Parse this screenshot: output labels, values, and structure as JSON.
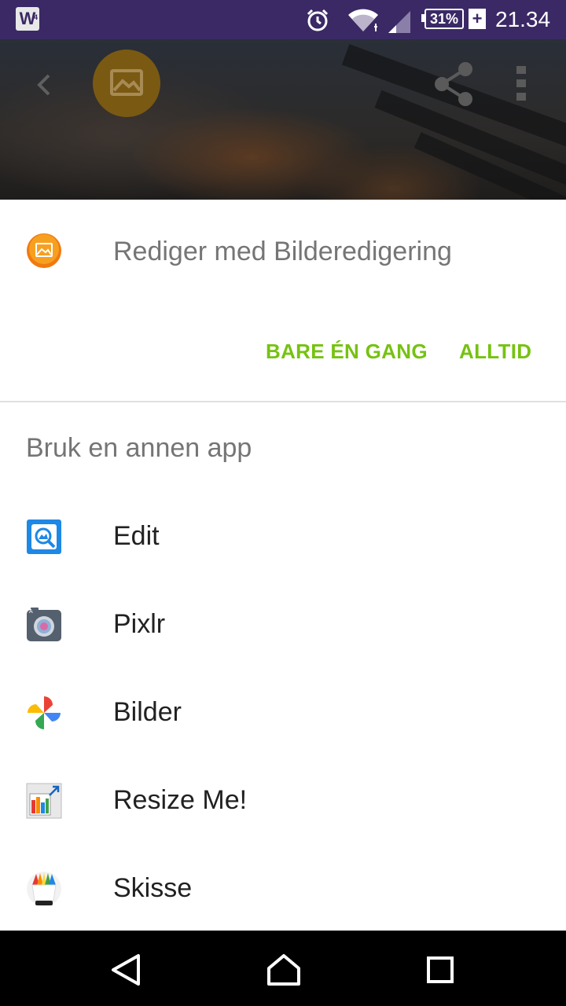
{
  "status_bar": {
    "notification_icon": "W",
    "battery": "31%",
    "charge_icon": "+",
    "time": "21.34",
    "icons": [
      "alarm-icon",
      "wifi-icon",
      "signal-icon",
      "battery-icon"
    ]
  },
  "header": {
    "icons": [
      "back-icon",
      "gallery-icon",
      "share-icon",
      "more-vert-icon"
    ]
  },
  "default_app": {
    "label": "Rediger med Bilderedigering",
    "icon": "photo-editor-icon",
    "just_once": "BARE ÉN GANG",
    "always": "ALLTID"
  },
  "other_apps": {
    "header": "Bruk en annen app",
    "items": [
      {
        "label": "Edit",
        "icon": "edit-app-icon"
      },
      {
        "label": "Pixlr",
        "icon": "pixlr-icon"
      },
      {
        "label": "Bilder",
        "icon": "google-photos-icon"
      },
      {
        "label": "Resize Me!",
        "icon": "resize-me-icon"
      },
      {
        "label": "Skisse",
        "icon": "sketch-icon"
      }
    ]
  },
  "nav_bar": {
    "icons": [
      "nav-back-icon",
      "nav-home-icon",
      "nav-recents-icon"
    ]
  },
  "colors": {
    "status_bar": "#3b2966",
    "accent": "#76c212",
    "secondary_text": "#757575",
    "primary_text": "#212121"
  }
}
